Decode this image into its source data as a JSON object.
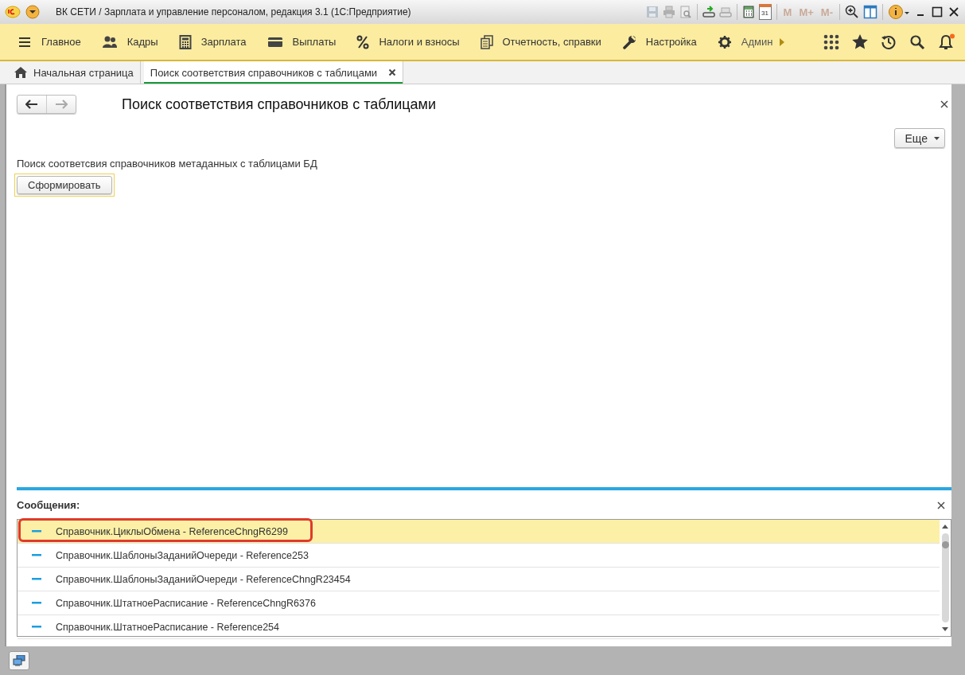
{
  "window": {
    "title": "ВК СЕТИ / Зарплата и управление персоналом, редакция 3.1  (1С:Предприятие)",
    "calendar_day": "31",
    "memory_buttons": [
      {
        "label": "M",
        "disabled": true
      },
      {
        "label": "M+",
        "disabled": true
      },
      {
        "label": "M-",
        "disabled": true
      }
    ]
  },
  "sections": [
    {
      "label": "Главное"
    },
    {
      "label": "Кадры"
    },
    {
      "label": "Зарплата"
    },
    {
      "label": "Выплаты"
    },
    {
      "label": "Налоги и взносы"
    },
    {
      "label": "Отчетность, справки"
    },
    {
      "label": "Настройка"
    },
    {
      "label": "Админ"
    }
  ],
  "notifications": {
    "unread": true
  },
  "tabs": [
    {
      "label": "Начальная страница",
      "selected": false,
      "kind": "home"
    },
    {
      "label": "Поиск соответствия справочников с таблицами",
      "selected": true,
      "kind": "page"
    }
  ],
  "form": {
    "title": "Поиск соответствия справочников с таблицами",
    "more_button": "Еще",
    "description": "Поиск соответсвия справочников метаданных с таблицами БД",
    "run_button": "Сформировать"
  },
  "messages": {
    "title": "Сообщения:",
    "items": [
      {
        "text": "Справочник.ЦиклыОбмена - ReferenceChngR6299",
        "selected": true,
        "highlighted": true
      },
      {
        "text": "Справочник.ШаблоныЗаданийОчереди - Reference253",
        "selected": false,
        "highlighted": false
      },
      {
        "text": "Справочник.ШаблоныЗаданийОчереди - ReferenceChngR23454",
        "selected": false,
        "highlighted": false
      },
      {
        "text": "Справочник.ШтатноеРасписание - ReferenceChngR6376",
        "selected": false,
        "highlighted": false
      },
      {
        "text": "Справочник.ШтатноеРасписание - Reference254",
        "selected": false,
        "highlighted": false
      }
    ]
  }
}
